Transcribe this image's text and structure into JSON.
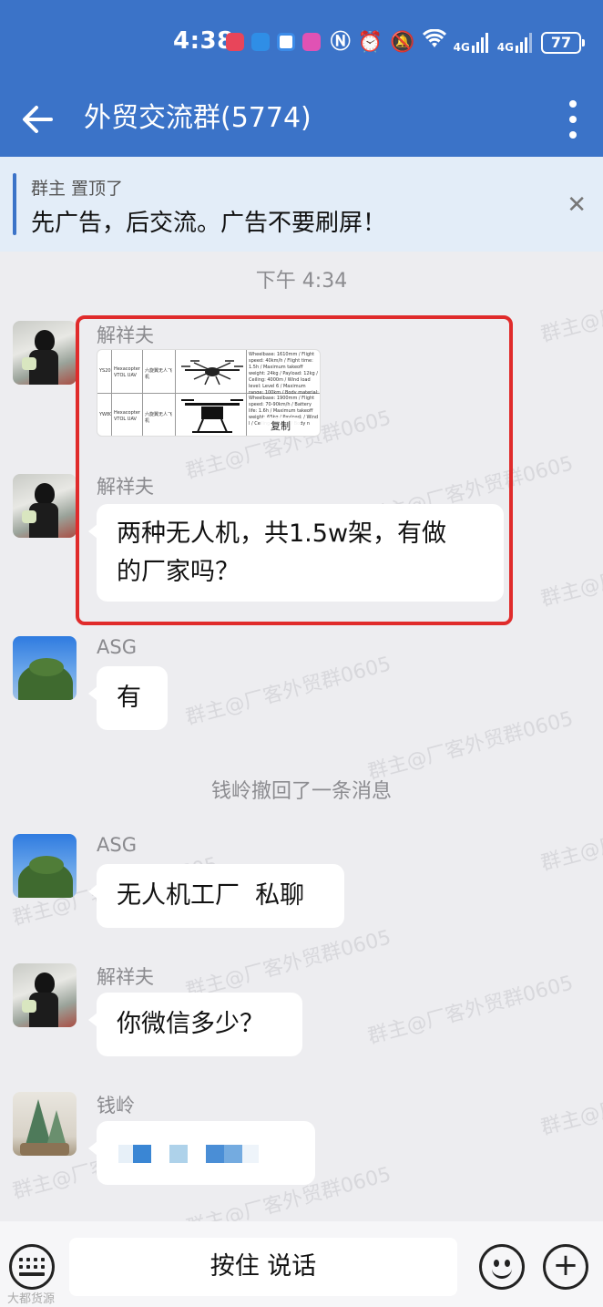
{
  "status_bar": {
    "time": "4:38",
    "signal_1": "4G",
    "signal_2": "4G",
    "battery": "77"
  },
  "header": {
    "title": "外贸交流群(5774)"
  },
  "pinned": {
    "subtitle": "群主 置顶了",
    "text": "先广告，后交流。广告不要刷屏！"
  },
  "chat": {
    "timestamp": "下午 4:34",
    "messages": [
      {
        "sender": "解祥夫",
        "type": "image",
        "copy_label": "复制"
      },
      {
        "sender": "解祥夫",
        "text_line1": "两种无人机，共1.5w架，有做",
        "text_line2": "的厂家吗？"
      },
      {
        "sender": "ASG",
        "text": "有"
      },
      {
        "system": "钱岭撤回了一条消息"
      },
      {
        "sender": "ASG",
        "text": "无人机工厂  私聊"
      },
      {
        "sender": "解祥夫",
        "text": "你微信多少？"
      },
      {
        "sender": "钱岭",
        "type": "redacted"
      }
    ],
    "image_rows": [
      {
        "model": "YS20",
        "type": "Hexacopter VTOL UAV",
        "name": "六旋翼无人飞机",
        "specs": "Wheelbase: 1610mm / Flight speed: 40km/h / Flight time: 1.5h / Maximum takeoff weight: 24kg / Payload: 12kg / Ceiling: 4000m / Wind load level: Level 6 / Maximum range: 100km / Body material: & carbon fiber"
      },
      {
        "model": "YW80",
        "type": "Hexacopter VTOL UAV",
        "name": "六旋翼无人飞机",
        "specs": "Wheelbase: 1900mm / Flight speed: 70-90km/h / Battery life: 1.6h / Maximum takeoff weight: 65kg / Payload: / Wind l / Ceiling / Maxim / Body n"
      }
    ]
  },
  "watermark": "群主@厂客外贸群0605",
  "input_bar": {
    "voice_label": "按住 说话"
  },
  "corner_mark": "大都货源",
  "colors": {
    "header_bg": "#3b73c8",
    "highlight_border": "#e02b2b",
    "chat_bg": "#ededf0"
  }
}
